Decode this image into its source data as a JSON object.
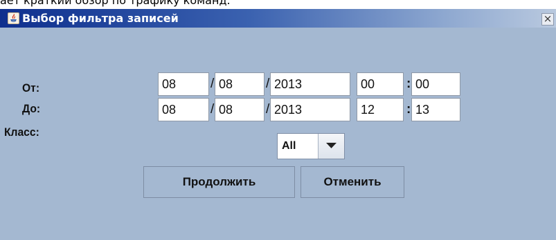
{
  "background": {
    "caption": "ает краткий обзор по трафику команд."
  },
  "dialog": {
    "title": "Выбор фильтра записей",
    "close_label": "×",
    "colors": {
      "body": "#a4b8d1",
      "titlebar_start": "#0e2f8e",
      "titlebar_end": "#b9c9df"
    },
    "from": {
      "label": "От:",
      "day": "08",
      "month": "08",
      "year": "2013",
      "hour": "00",
      "minute": "00"
    },
    "to": {
      "label": "До:",
      "day": "08",
      "month": "08",
      "year": "2013",
      "hour": "12",
      "minute": "13"
    },
    "separators": {
      "date": "/",
      "time": ":"
    },
    "class": {
      "label": "Класс:",
      "selected": "All",
      "arrow_icon": "triangle-down-icon"
    },
    "buttons": {
      "continue": "Продолжить",
      "cancel": "Отменить"
    }
  }
}
